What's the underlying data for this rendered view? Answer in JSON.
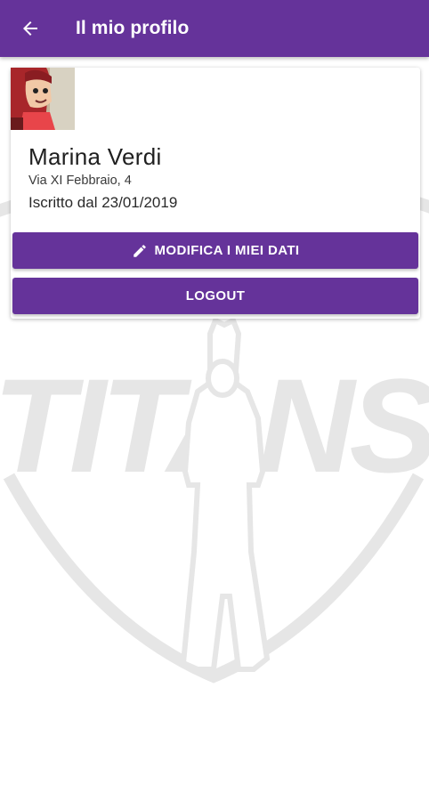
{
  "appbar": {
    "title": "Il mio profilo",
    "back_icon": "arrow-back-icon",
    "color": "#65339a"
  },
  "profile": {
    "avatar_icon": "avatar-cartoon-girl",
    "name": "Marina Verdi",
    "address": "Via XI Febbraio, 4",
    "member_since": "Iscritto dal 23/01/2019"
  },
  "actions": {
    "edit_label": "MODIFICA I MIEI DATI",
    "edit_icon": "pencil-icon",
    "logout_label": "LOGOUT"
  },
  "background": {
    "watermark_text": "TITANS",
    "watermark_color": "#e6e6e6"
  }
}
